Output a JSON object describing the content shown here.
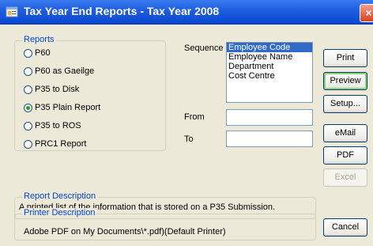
{
  "window": {
    "title": "Tax Year End Reports - Tax Year 2008",
    "close_glyph": "×"
  },
  "reports": {
    "legend": "Reports",
    "options": [
      {
        "label": "P60",
        "checked": false
      },
      {
        "label": "P60 as Gaeilge",
        "checked": false
      },
      {
        "label": "P35 to Disk",
        "checked": false
      },
      {
        "label": "P35 Plain Report",
        "checked": true
      },
      {
        "label": "P35 to ROS",
        "checked": false
      },
      {
        "label": "PRC1 Report",
        "checked": false
      }
    ]
  },
  "sequence": {
    "label": "Sequence",
    "items": [
      "Employee Code",
      "Employee Name",
      "Department",
      "Cost Centre"
    ],
    "selected": "Employee Code"
  },
  "range": {
    "from_label": "From",
    "from_value": "",
    "to_label": "To",
    "to_value": ""
  },
  "buttons": {
    "print": "Print",
    "preview": "Preview",
    "setup": "Setup...",
    "email": "eMail",
    "pdf": "PDF",
    "excel": "Excel",
    "cancel": "Cancel"
  },
  "report_description": {
    "legend": "Report Description",
    "text": "A printed list of the information that is stored on a P35 Submission."
  },
  "printer_description": {
    "legend": "Printer Description",
    "text": "Adobe PDF on My Documents\\*.pdf)(Default Printer)"
  },
  "colors": {
    "titlebar": "#0a47d1",
    "legend_text": "#0046d5",
    "selection": "#316ac5"
  }
}
